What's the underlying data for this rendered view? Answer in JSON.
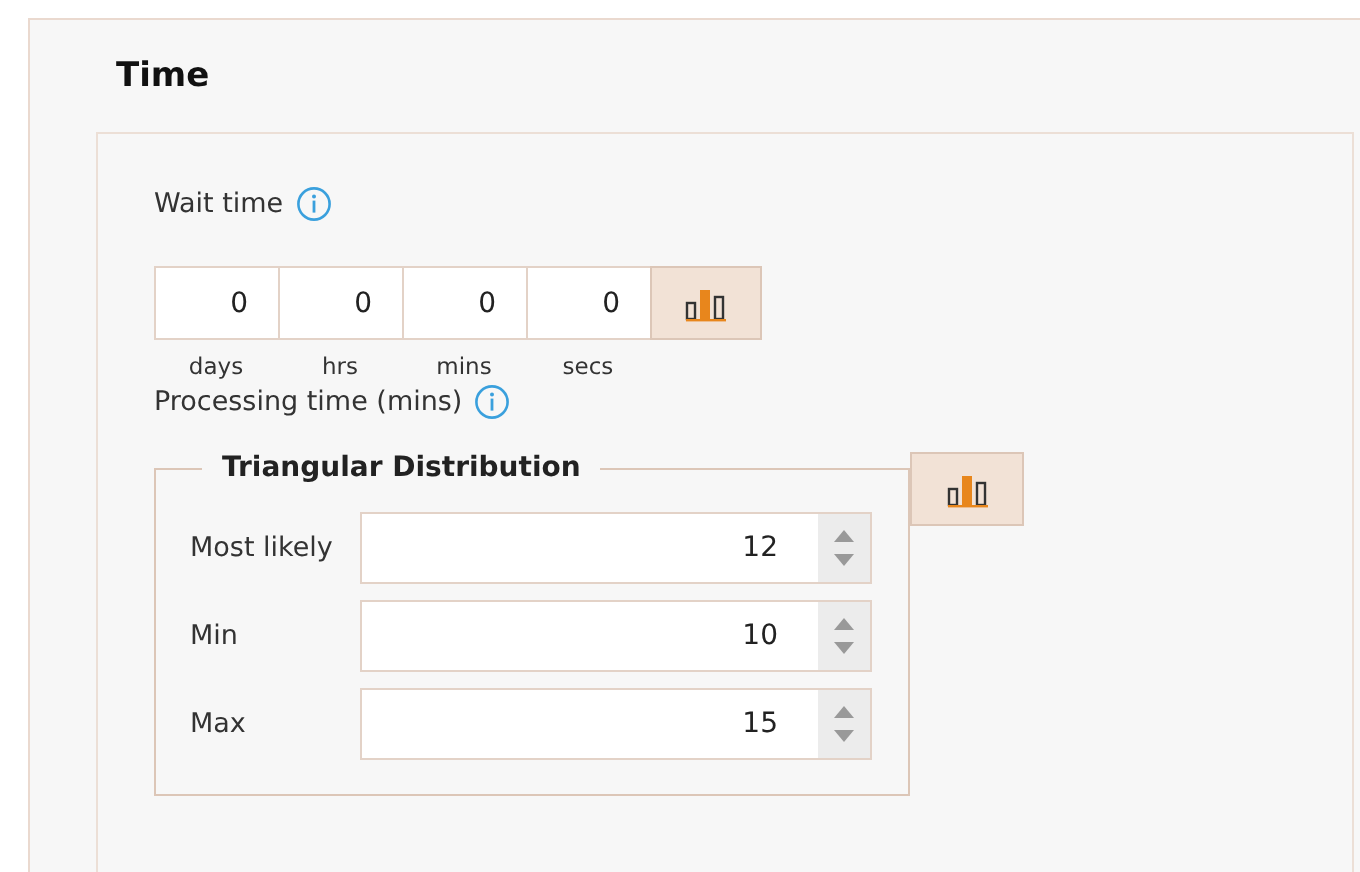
{
  "section": {
    "title": "Time"
  },
  "wait_time": {
    "label": "Wait time",
    "fields": [
      {
        "value": "0",
        "unit": "days"
      },
      {
        "value": "0",
        "unit": "hrs"
      },
      {
        "value": "0",
        "unit": "mins"
      },
      {
        "value": "0",
        "unit": "secs"
      }
    ]
  },
  "processing_time": {
    "label": "Processing time (mins)",
    "distribution": {
      "title": "Triangular Distribution",
      "fields": [
        {
          "label": "Most likely",
          "value": "12"
        },
        {
          "label": "Min",
          "value": "10"
        },
        {
          "label": "Max",
          "value": "15"
        }
      ]
    }
  }
}
